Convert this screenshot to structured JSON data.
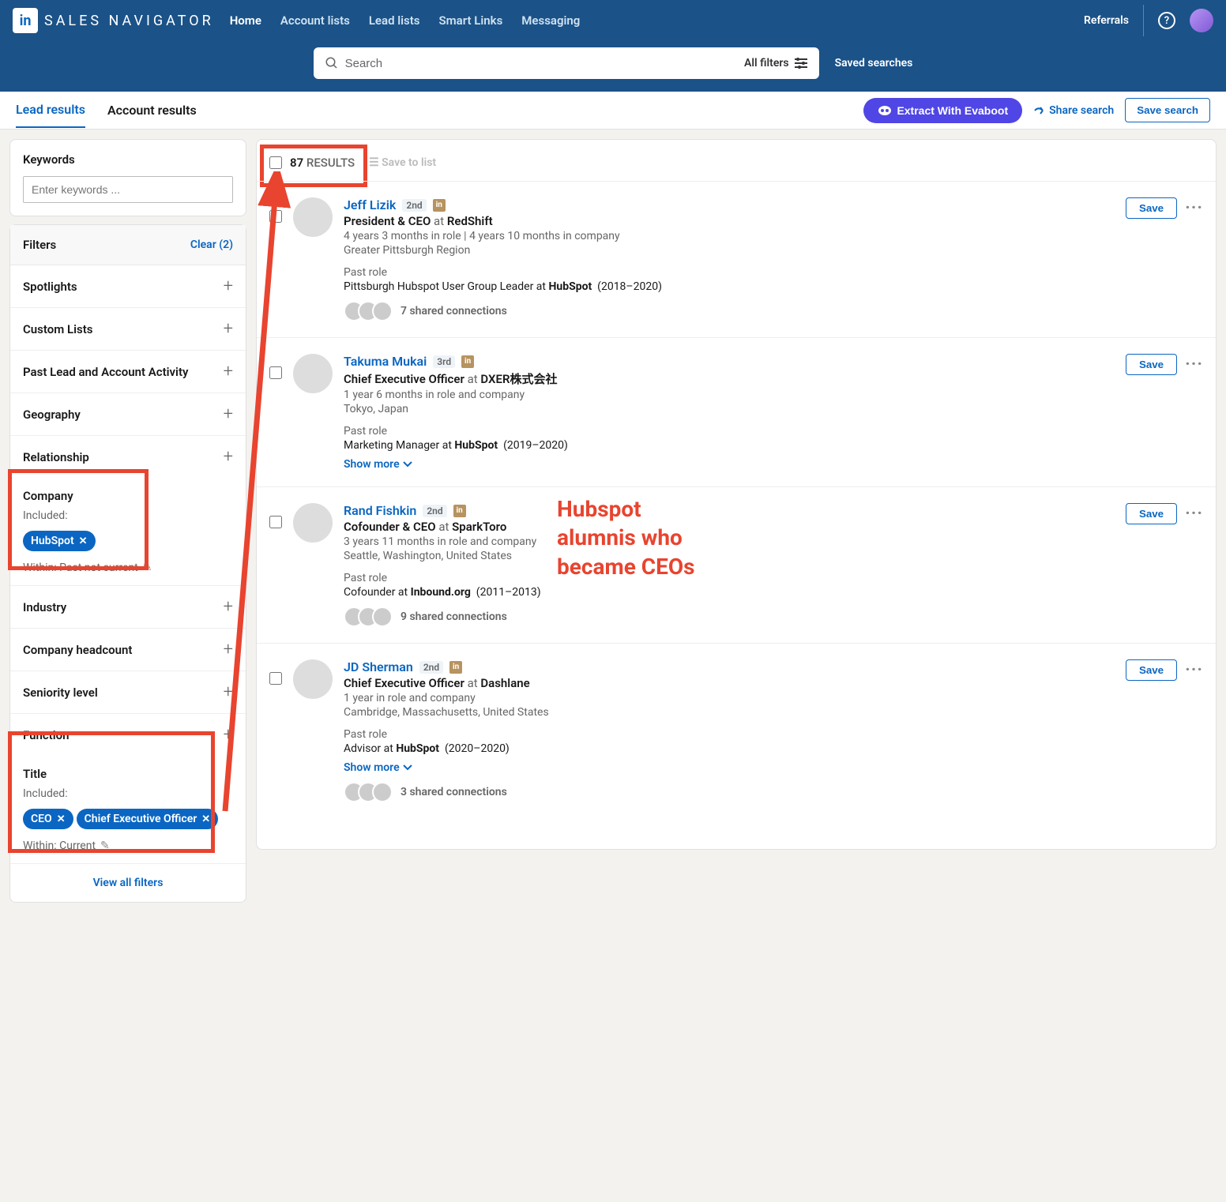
{
  "brand": "SALES NAVIGATOR",
  "nav": {
    "home": "Home",
    "accounts": "Account lists",
    "leads": "Lead lists",
    "smart": "Smart Links",
    "messaging": "Messaging",
    "referrals": "Referrals"
  },
  "search": {
    "placeholder": "Search",
    "all_filters": "All filters",
    "saved": "Saved searches"
  },
  "tabs": {
    "lead": "Lead results",
    "account": "Account results",
    "extract": "Extract With Evaboot",
    "share": "Share search",
    "save": "Save search"
  },
  "keywords": {
    "heading": "Keywords",
    "placeholder": "Enter keywords ..."
  },
  "filters_head": {
    "title": "Filters",
    "clear": "Clear (2)"
  },
  "filter_items": [
    "Spotlights",
    "Custom Lists",
    "Past Lead and Account Activity",
    "Geography",
    "Relationship"
  ],
  "company_filter": {
    "label": "Company",
    "included": "Included:",
    "chip": "HubSpot",
    "within": "Within: Past not current"
  },
  "mid_filter_items": [
    "Industry",
    "Company headcount",
    "Seniority level",
    "Function"
  ],
  "title_filter": {
    "label": "Title",
    "included": "Included:",
    "chips": [
      "CEO",
      "Chief Executive Officer"
    ],
    "within": "Within: Current"
  },
  "view_all": "View all filters",
  "results_count": {
    "num": "87",
    "label": "RESULTS",
    "save_list": "Save to list",
    "save": "Save"
  },
  "annotation_text": {
    "l1": "Hubspot",
    "l2": "alumnis who",
    "l3": "became CEOs"
  },
  "results": [
    {
      "name": "Jeff Lizik",
      "degree": "2nd",
      "title": "President & CEO",
      "company": "RedShift",
      "tenure": "4 years 3 months in role  |  4 years 10 months in company",
      "location": "Greater Pittsburgh Region",
      "past_title": "Pittsburgh Hubspot User Group Leader",
      "past_company": "HubSpot",
      "past_years": "(2018–2020)",
      "connections": "7 shared connections",
      "show_more": false,
      "conn_row": true
    },
    {
      "name": "Takuma Mukai",
      "degree": "3rd",
      "title": "Chief Executive Officer",
      "company": "DXER株式会社",
      "tenure": "1 year 6 months in role and company",
      "location": "Tokyo, Japan",
      "past_title": "Marketing Manager",
      "past_company": "HubSpot",
      "past_years": "(2019–2020)",
      "show_more": true,
      "conn_row": false
    },
    {
      "name": "Rand Fishkin",
      "degree": "2nd",
      "title": "Cofounder & CEO",
      "company": "SparkToro",
      "tenure": "3 years 11 months in role and company",
      "location": "Seattle, Washington, United States",
      "past_title": "Cofounder",
      "past_company": "Inbound.org",
      "past_years": "(2011–2013)",
      "connections": "9 shared connections",
      "show_more": false,
      "conn_row": true
    },
    {
      "name": "JD Sherman",
      "degree": "2nd",
      "title": "Chief Executive Officer",
      "company": "Dashlane",
      "tenure": "1 year in role and company",
      "location": "Cambridge, Massachusetts, United States",
      "past_title": "Advisor",
      "past_company": "HubSpot",
      "past_years": "(2020–2020)",
      "connections": "3 shared connections",
      "show_more": true,
      "conn_row": true
    }
  ],
  "labels": {
    "past_role": "Past role",
    "show_more": "Show more",
    "at": "at"
  }
}
